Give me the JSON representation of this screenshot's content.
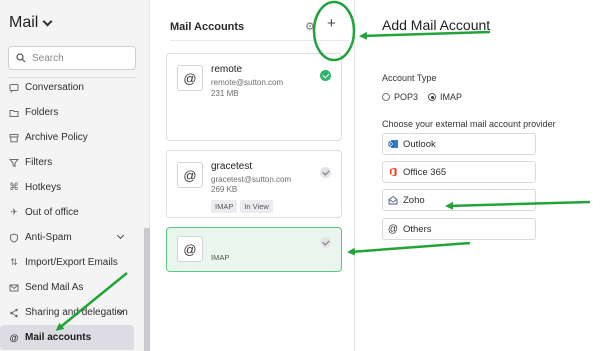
{
  "sidebar": {
    "title": "Mail",
    "search_placeholder": "Search",
    "items": [
      {
        "label": "Conversation"
      },
      {
        "label": "Folders"
      },
      {
        "label": "Archive Policy"
      },
      {
        "label": "Filters"
      },
      {
        "label": "Hotkeys"
      },
      {
        "label": "Out of office"
      },
      {
        "label": "Anti-Spam"
      },
      {
        "label": "Import/Export Emails"
      },
      {
        "label": "Send Mail As"
      },
      {
        "label": "Sharing and delegation"
      },
      {
        "label": "Mail accounts"
      }
    ]
  },
  "middle": {
    "title": "Mail Accounts",
    "accounts": [
      {
        "name": "remote",
        "email": "remote@sutton.com",
        "size": "231 MB"
      },
      {
        "name": "gracetest",
        "email": "gracetest@sutton.com",
        "size": "269 KB",
        "tags": [
          "IMAP",
          "In View"
        ]
      },
      {
        "tag": "IMAP"
      }
    ]
  },
  "right": {
    "title": "Add Mail Account",
    "account_type_label": "Account Type",
    "options": [
      "POP3",
      "IMAP"
    ],
    "selected_option": "IMAP",
    "provider_label": "Choose your external mail account provider",
    "providers": [
      "Outlook",
      "Office 365",
      "Zoho",
      "Others"
    ]
  },
  "colors": {
    "annotation": "#22a33a",
    "selected_bg": "#e8f6ee",
    "check_green": "#2fb56a"
  }
}
